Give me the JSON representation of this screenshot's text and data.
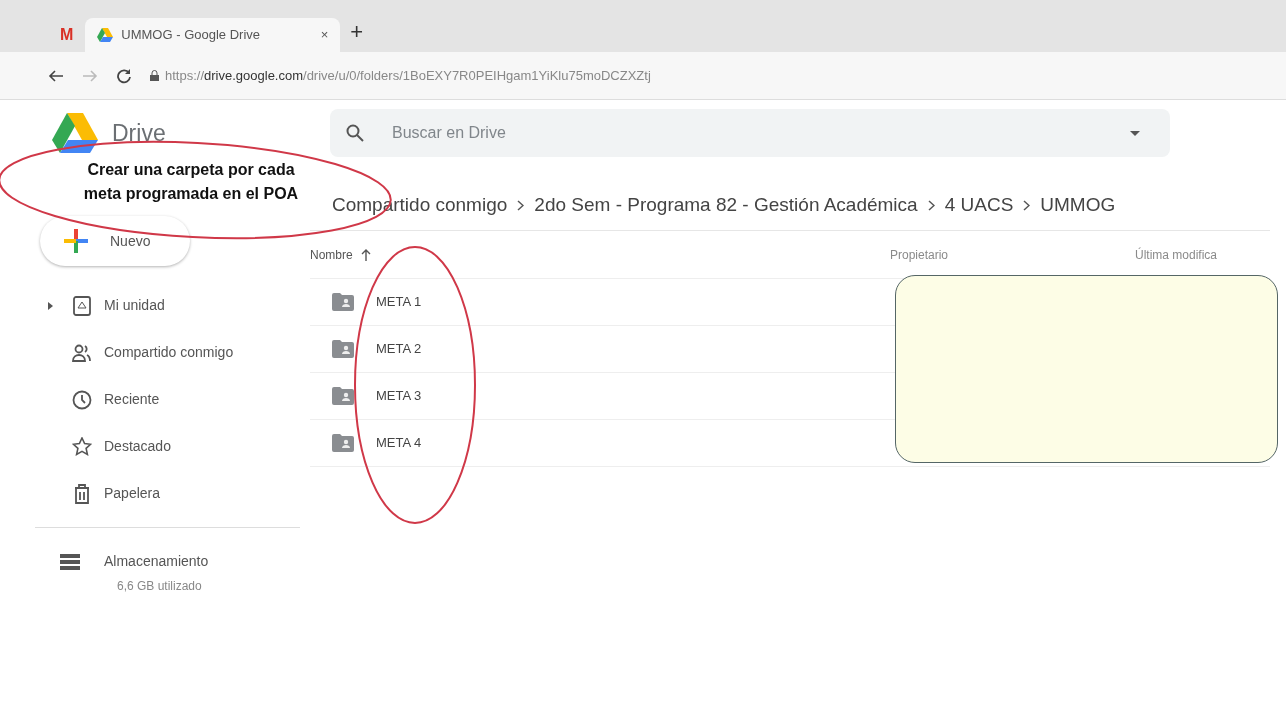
{
  "browser": {
    "tabs": [
      {
        "kind": "gmail",
        "label": "M",
        "selected": false
      },
      {
        "kind": "drive",
        "label": "UMMOG - Google Drive",
        "close": "×",
        "selected": true
      }
    ],
    "new_tab": "+",
    "url": {
      "scheme": "https://",
      "host": "drive.google.com",
      "path": "/drive/u/0/folders/1BoEXY7R0PEIHgam1YiKlu75moDCZXZtj"
    }
  },
  "drive": {
    "logo_text": "Drive",
    "search": {
      "placeholder": "Buscar en Drive"
    },
    "new_button": "Nuevo",
    "sidebar": {
      "items": [
        {
          "label": "Mi unidad",
          "expandable": true
        },
        {
          "label": "Compartido conmigo",
          "expandable": false
        },
        {
          "label": "Reciente",
          "expandable": false
        },
        {
          "label": "Destacado",
          "expandable": false
        },
        {
          "label": "Papelera",
          "expandable": false
        }
      ],
      "storage": {
        "label": "Almacenamiento",
        "used": "6,6 GB utilizado"
      }
    },
    "breadcrumbs": [
      "Compartido conmigo",
      "2do Sem - Programa 82 - Gestión Académica",
      "4 UACS",
      "UMMOG"
    ],
    "table": {
      "columns": [
        {
          "label": "Nombre",
          "sorted": true
        },
        {
          "label": "Propietario",
          "sorted": false
        },
        {
          "label": "Última modifica",
          "sorted": false
        }
      ],
      "rows": [
        {
          "name": "META 1"
        },
        {
          "name": "META 2"
        },
        {
          "name": "META 3"
        },
        {
          "name": "META 4"
        }
      ]
    }
  },
  "annotation": {
    "note": "Crear una carpeta por cada meta programada en el POA"
  }
}
